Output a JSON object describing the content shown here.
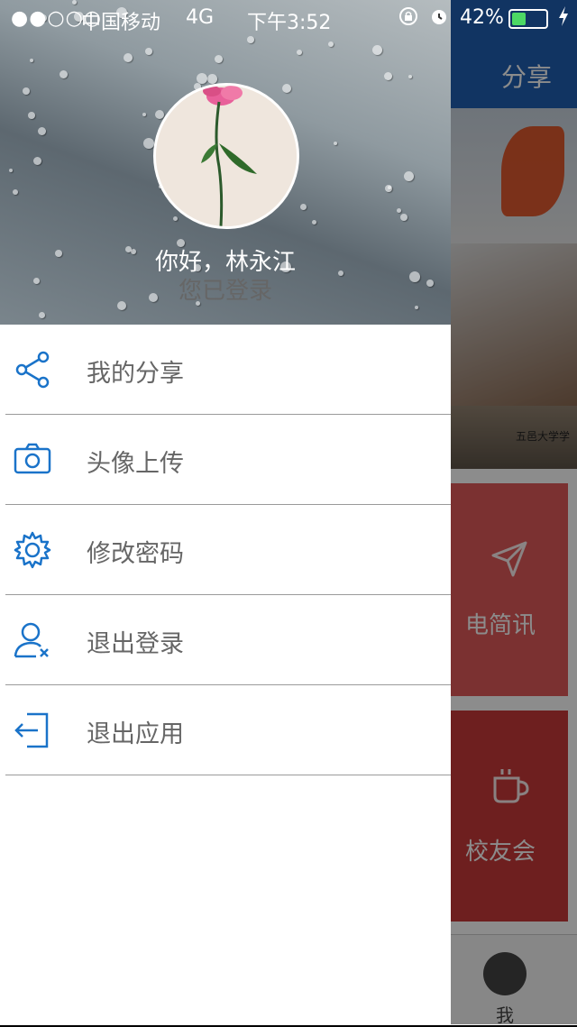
{
  "status_bar": {
    "signal": "●●○○○",
    "carrier": "中国移动",
    "network": "4G",
    "time": "下午3:52",
    "battery_text": "42%",
    "battery_level": 0.42
  },
  "background": {
    "header_action": "分享",
    "banner_caption": "五邑大学学",
    "tiles": [
      {
        "label": "电简讯",
        "icon": "send-icon"
      },
      {
        "label": "校友会",
        "icon": "coffee-icon"
      }
    ],
    "tab_label": "我"
  },
  "drawer": {
    "greeting": "你好，林永江",
    "status": "您已登录",
    "menu": [
      {
        "label": "我的分享",
        "icon": "share-icon"
      },
      {
        "label": "头像上传",
        "icon": "camera-icon"
      },
      {
        "label": "修改密码",
        "icon": "gear-icon"
      },
      {
        "label": "退出登录",
        "icon": "user-logout-icon"
      },
      {
        "label": "退出应用",
        "icon": "exit-app-icon"
      }
    ],
    "accent_color": "#1a73c9"
  }
}
